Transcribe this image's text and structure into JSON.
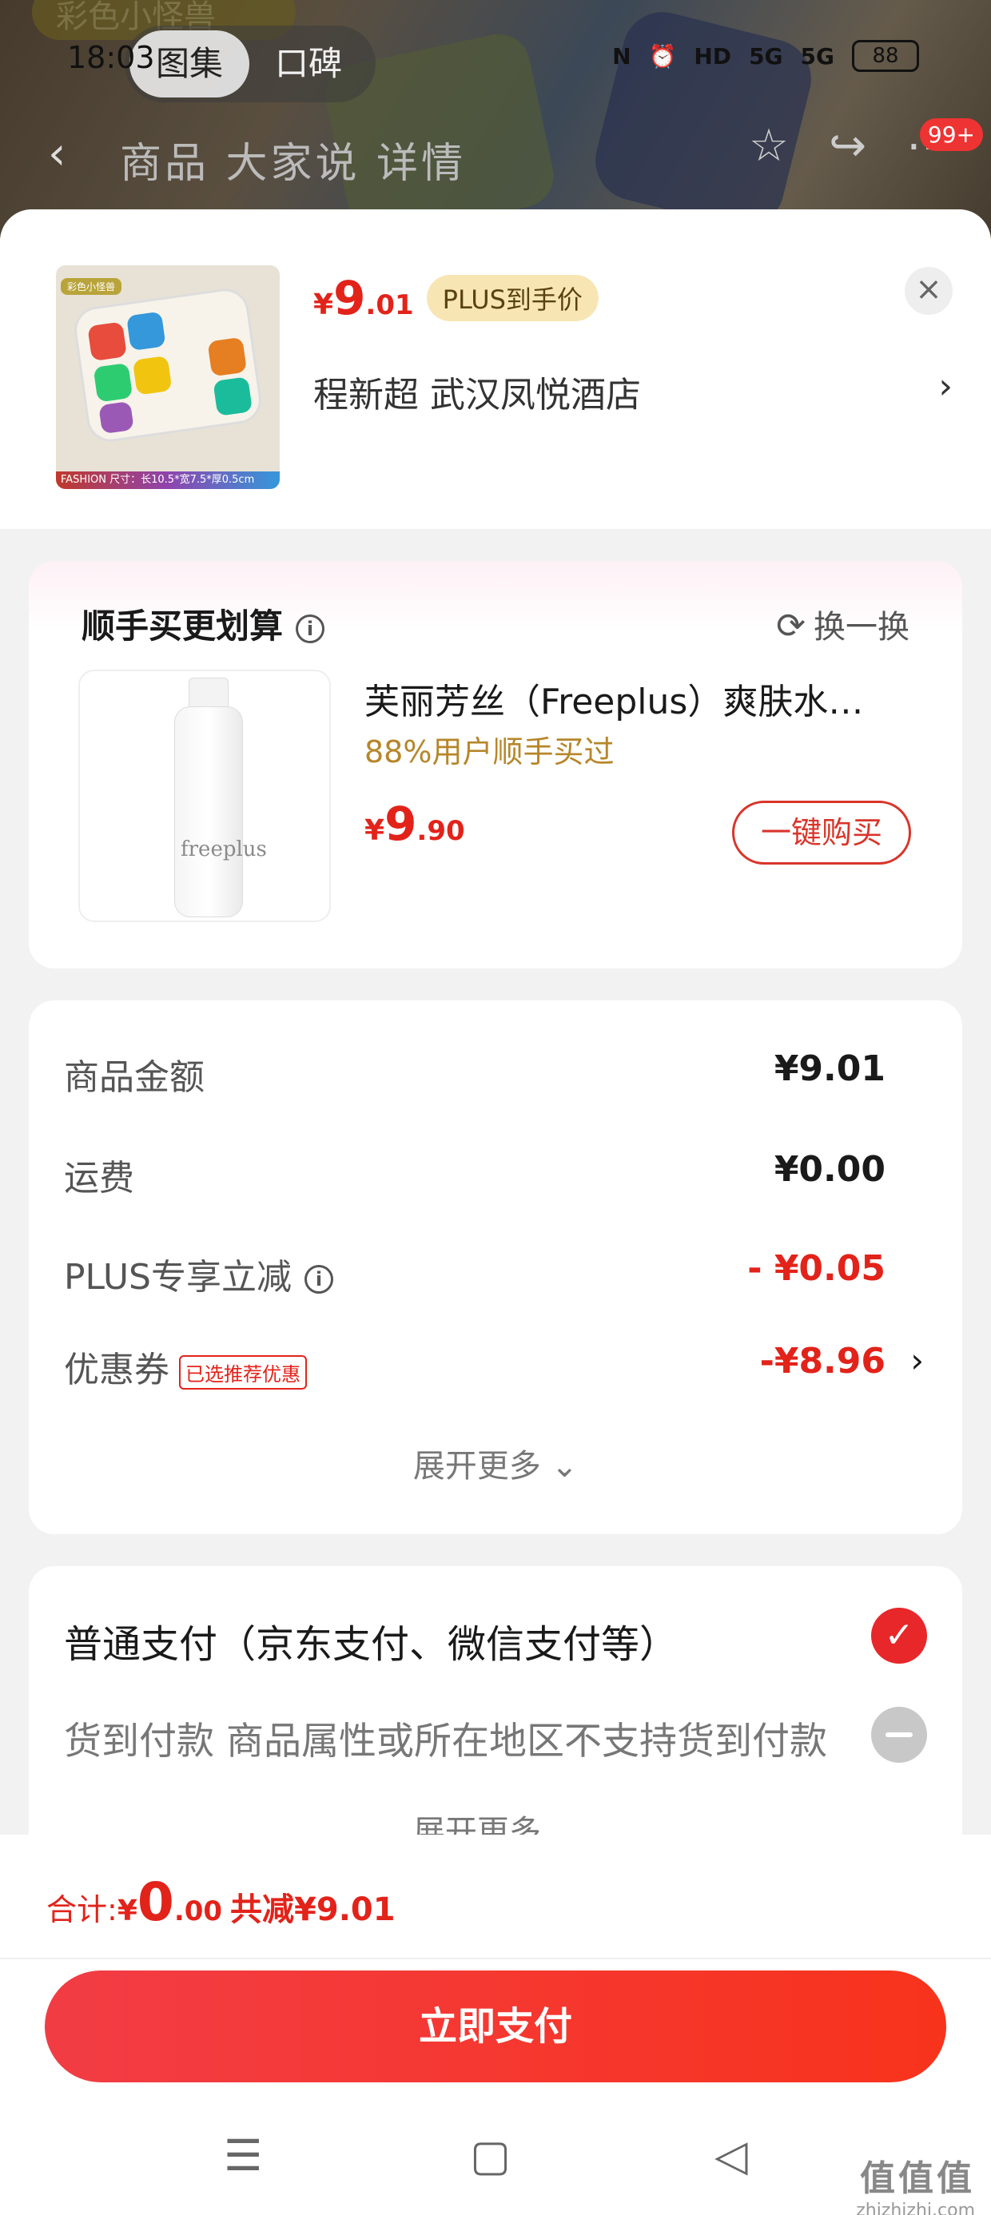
{
  "status_bar": {
    "time": "18:03",
    "tabs": [
      "图集",
      "口碑"
    ],
    "network_icons": [
      "N",
      "HD",
      "5G",
      "5G"
    ],
    "battery": "88"
  },
  "bg_nav": {
    "back": "‹",
    "tabs": "商品 大家说 详情",
    "badge": "99+",
    "banner_text": "彩色小怪兽"
  },
  "header": {
    "price_currency": "¥",
    "price_int": "9",
    "price_dec": ".01",
    "plus_tag": "PLUS到手价",
    "address": "程新超  武汉凤悦酒店",
    "close": "×",
    "arrow": "›",
    "thumb_tag": "彩色小怪兽",
    "thumb_bar": "FASHION   尺寸：长10.5*宽7.5*厚0.5cm"
  },
  "addon": {
    "title": "顺手买更划算",
    "info": "i",
    "swap_label": "换一换",
    "product_name": "芙丽芳丝（Freeplus）爽肤水…",
    "product_sub": "88%用户顺手买过",
    "price_currency": "¥",
    "price_int": "9",
    "price_dec": ".90",
    "buy_label": "一键购买",
    "bottle_brand": "freeplus"
  },
  "summary": {
    "rows": [
      {
        "label": "商品金额",
        "value": "¥9.01"
      },
      {
        "label": "运费",
        "value": "¥0.00"
      },
      {
        "label": "PLUS专享立减",
        "value": "- ¥0.05"
      },
      {
        "label": "优惠券",
        "value": "-¥8.96",
        "tag": "已选推荐优惠"
      }
    ],
    "expand": "展开更多 ⌄"
  },
  "payment": {
    "option1": "普通支付（京东支付、微信支付等）",
    "option2": "货到付款 商品属性或所在地区不支持货到付款",
    "expand": "展开更多 ⌄"
  },
  "footer": {
    "total_label": "合计: ",
    "total_currency": "¥",
    "total_int": "0",
    "total_dec": ".00",
    "saved": "共减¥9.01",
    "pay_button": "立即支付"
  },
  "watermark": {
    "logo": "值值值",
    "url": "zhizhizhi.com"
  },
  "colors": {
    "accent": "#e2231a",
    "plus_tag_bg": "#f7e6b4",
    "pay_button": "#f23c45"
  }
}
